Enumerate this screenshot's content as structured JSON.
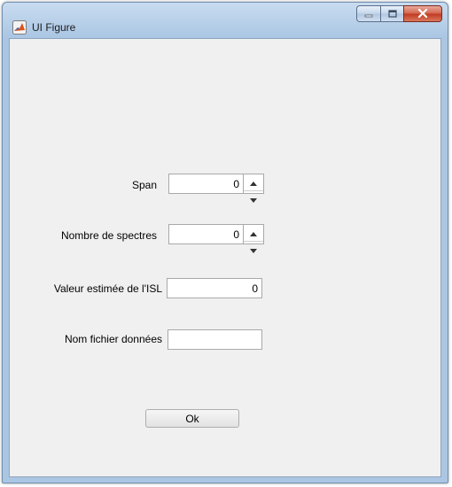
{
  "window": {
    "title": "UI Figure"
  },
  "form": {
    "span": {
      "label": "Span",
      "value": "0"
    },
    "nombre_spectres": {
      "label": "Nombre de spectres",
      "value": "0"
    },
    "valeur_isl": {
      "label": "Valeur estimée de l'ISL",
      "value": "0"
    },
    "nom_fichier": {
      "label": "Nom fichier données",
      "value": ""
    },
    "ok_label": "Ok"
  },
  "icons": {
    "app": "matlab-icon",
    "minimize": "minimize-icon",
    "maximize": "maximize-icon",
    "close": "close-icon",
    "spin_up": "chevron-up-icon",
    "spin_down": "chevron-down-icon"
  },
  "colors": {
    "titlebar": "#aac6e3",
    "client_bg": "#f0f0f0",
    "close_button": "#c0391f"
  }
}
